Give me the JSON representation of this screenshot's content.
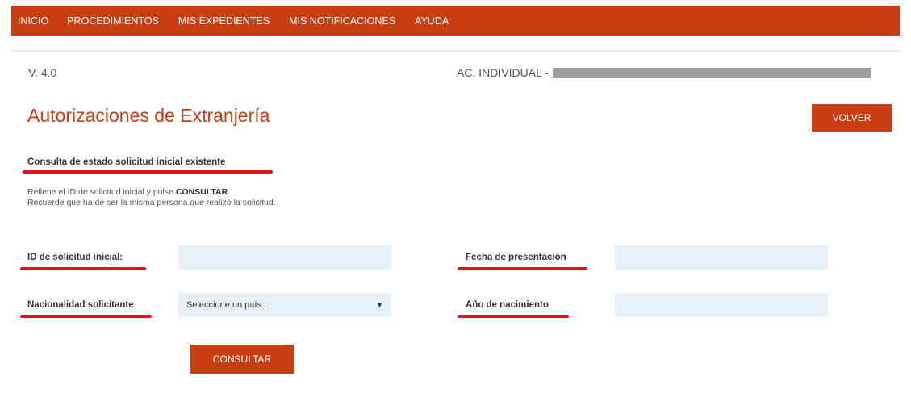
{
  "nav": {
    "items": [
      {
        "label": "INICIO"
      },
      {
        "label": "PROCEDIMIENTOS"
      },
      {
        "label": "MIS EXPEDIENTES"
      },
      {
        "label": "MIS NOTIFICACIONES"
      },
      {
        "label": "AYUDA"
      }
    ],
    "background": "#c93d13"
  },
  "header": {
    "version": "V. 4.0",
    "account_label": "AC. INDIVIDUAL -"
  },
  "page": {
    "title": "Autorizaciones de Extranjería",
    "back_button": "VOLVER"
  },
  "section": {
    "title": "Consulta de estado solicitud inicial existente",
    "instruction_prefix": "Rellene el ID de solicitud inicial y pulse ",
    "instruction_bold": "CONSULTAR",
    "instruction_suffix": ".",
    "instruction_line2": "Recuerde que ha de ser la misma persona que realizó la solicitud."
  },
  "form": {
    "id_label": "ID de solicitud inicial:",
    "id_value": "",
    "fecha_label": "Fecha de presentación",
    "fecha_value": "",
    "nacionalidad_label": "Nacionalidad solicitante",
    "nacionalidad_selected": "Seleccione un país...",
    "anio_label": "Año de nacimiento",
    "anio_value": "",
    "submit_label": "CONSULTAR"
  },
  "colors": {
    "accent": "#c93d13",
    "annotation_underline": "#e0131b",
    "input_background": "#e6f1f8"
  }
}
